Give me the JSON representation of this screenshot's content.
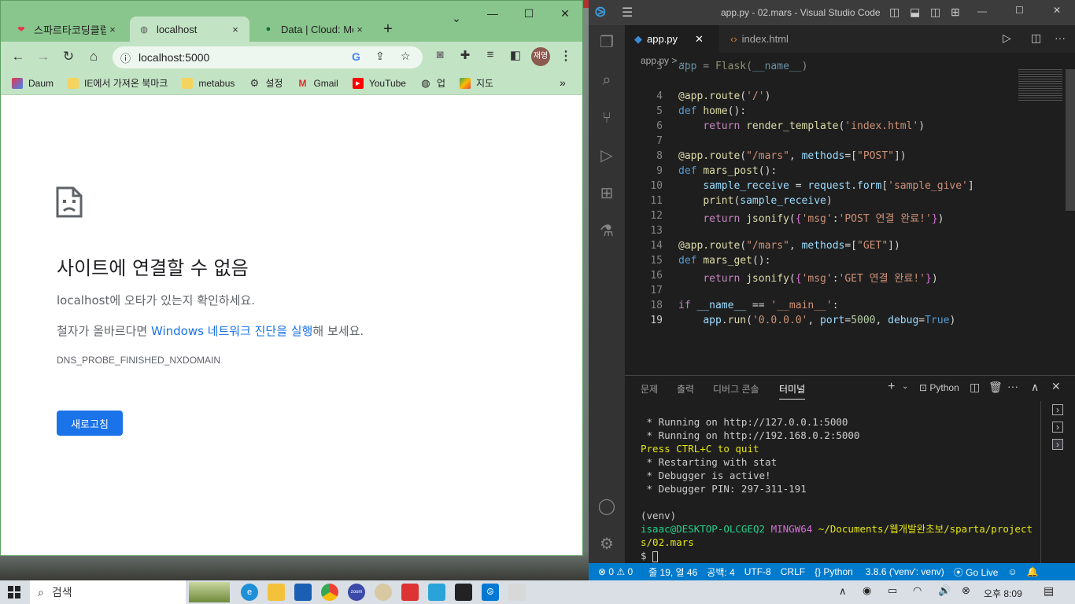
{
  "chrome": {
    "tabs": [
      {
        "title": "스파르타코딩클럽",
        "close": "×"
      },
      {
        "title": "localhost",
        "close": "×"
      },
      {
        "title": "Data | Cloud: Mo",
        "close": "×"
      }
    ],
    "new_tab": "+",
    "address": "localhost:5000",
    "profile": "재영",
    "bookmarks": [
      {
        "label": "Daum"
      },
      {
        "label": "IE에서 가져온 북마크"
      },
      {
        "label": "metabus"
      },
      {
        "label": "설정"
      },
      {
        "label": "Gmail"
      },
      {
        "label": "YouTube"
      },
      {
        "label": "업"
      },
      {
        "label": "지도"
      }
    ],
    "more": "»",
    "error": {
      "title": "사이트에 연결할 수 없음",
      "line1": "localhost에 오타가 있는지 확인하세요.",
      "line2_pre": "철자가 올바르다면 ",
      "line2_link": "Windows 네트워크 진단을 실행",
      "line2_post": "해 보세요.",
      "code": "DNS_PROBE_FINISHED_NXDOMAIN",
      "reload": "새로고침"
    }
  },
  "vscode": {
    "title": "app.py - 02.mars - Visual Studio Code",
    "tabs": [
      {
        "label": "app.py"
      },
      {
        "label": "index.html"
      }
    ],
    "breadcrumb": "app.py > ...",
    "code_lines": [
      "3",
      "4",
      "5",
      "6",
      "7",
      "8",
      "9",
      "10",
      "11",
      "12",
      "13",
      "14",
      "15",
      "16",
      "17",
      "18",
      "19"
    ],
    "panel_tabs": [
      "문제",
      "출력",
      "디버그 콘솔",
      "터미널"
    ],
    "terminal_profile": "Python",
    "terminal": [
      " * Running on http://127.0.0.1:5000",
      " * Running on http://192.168.0.2:5000",
      "Press CTRL+C to quit",
      " * Restarting with stat",
      " * Debugger is active!",
      " * Debugger PIN: 297-311-191",
      "",
      "(venv)"
    ],
    "prompt_user": "isaac@DESKTOP-OLCGEQ2",
    "prompt_env": "MINGW64",
    "prompt_path1": "~/Documents/웹개발완초보/sparta/project",
    "prompt_path2": "s/02.mars",
    "prompt_symbol": "$",
    "status": {
      "errors": "⊗ 0 ⚠ 0",
      "position": "줄 19, 열 46",
      "spaces": "공백: 4",
      "encoding": "UTF-8",
      "eol": "CRLF",
      "lang": "{} Python",
      "interpreter": "3.8.6 ('venv': venv)",
      "golive": "Go Live"
    }
  },
  "taskbar": {
    "search": "검색",
    "time": "오후 8:09"
  }
}
